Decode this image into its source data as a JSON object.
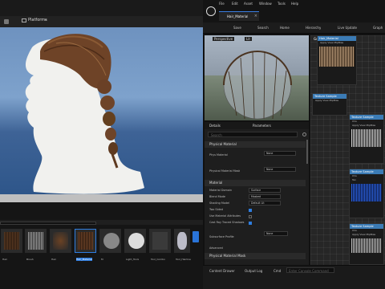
{
  "viewport": {
    "platforms_label": "Platforms"
  },
  "content_browser": {
    "items": [
      {
        "label": "Hair",
        "color": "#5a3a22"
      },
      {
        "label": "Brush",
        "color": "#777777"
      },
      {
        "label": "Hair",
        "color": "#6b4224"
      },
      {
        "label": "Hair_Material",
        "color": "#5e3c22"
      },
      {
        "label": "M",
        "color": "#888888"
      },
      {
        "label": "Light_Tools",
        "color": "#dddddd"
      },
      {
        "label": "Tool_Combo",
        "color": "#444444"
      },
      {
        "label": "Tool_Hair",
        "color": "#333333"
      },
      {
        "label": "Tool_Hair",
        "color": "#3a2a20"
      },
      {
        "label": "Tool_Hairline",
        "color": "#bcbcc8"
      }
    ]
  },
  "editor": {
    "tab_title": "Hair_Material",
    "menu": [
      "File",
      "Edit",
      "Asset",
      "Window",
      "Tools",
      "Help"
    ],
    "toolbar": {
      "save": "Save",
      "search": "Search",
      "home": "Home",
      "hierarchy": "Hierarchy",
      "live_update": "Live Update",
      "graph": "Graph"
    },
    "preview_tab": "Perspective",
    "preview_mode": "Lit",
    "details_tab": "Details",
    "parameters_tab": "Parameters",
    "search_placeholder": "Search",
    "sections": {
      "physical": "Physical Material",
      "material": "Material",
      "advanced": "Advanced",
      "physical_mask": "Physical Material Mask"
    },
    "props": [
      {
        "label": "Phys Material",
        "value": "None"
      },
      {
        "label": "Physical Material Mask",
        "value": "None"
      },
      {
        "label": "Material Domain",
        "value": "Surface"
      },
      {
        "label": "Blend Mode",
        "value": "Masked"
      },
      {
        "label": "Shading Model",
        "value": "Default Lit"
      },
      {
        "label": "Two Sided",
        "value": ""
      },
      {
        "label": "Use Material Attributes",
        "value": ""
      },
      {
        "label": "Cast Ray Traced Shadows",
        "value": ""
      },
      {
        "label": "Subsurface Profile",
        "value": "None"
      }
    ],
    "graph": {
      "graph_label": "Graph",
      "hair_node": "Hair_Material",
      "texture_node": "Texture Sample",
      "pins": [
        "Apply View MipBias",
        "UVs",
        "Tex",
        "RGBA",
        "RGB",
        "R",
        "G",
        "B",
        "A"
      ]
    },
    "status": {
      "content_drawer": "Content Drawer",
      "output_log": "Output Log",
      "cmd": "Cmd",
      "cmd_placeholder": "Enter Console Command"
    }
  }
}
